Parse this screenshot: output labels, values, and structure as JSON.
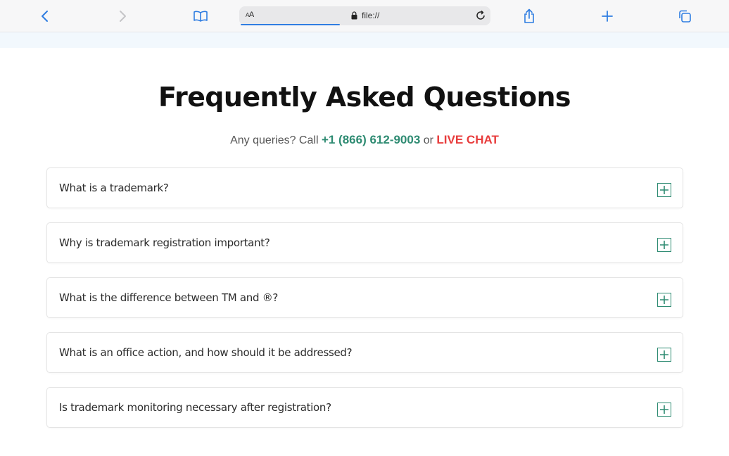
{
  "browser": {
    "url_text_size_label_small": "A",
    "url_text_size_label_large": "A",
    "url": "file://",
    "icons": {
      "back": "chevron-left-icon",
      "forward": "chevron-right-icon",
      "reader": "book-icon",
      "lock": "lock-icon",
      "reload": "reload-icon",
      "share": "share-icon",
      "new_tab": "plus-icon",
      "tabs": "tabs-icon"
    },
    "accent_color": "#2f7de1"
  },
  "page": {
    "title": "Frequently Asked Questions",
    "subtitle": {
      "prefix": "Any queries? Call ",
      "phone": "+1 (866) 612-9003",
      "middle": " or ",
      "chat": "LIVE CHAT"
    },
    "colors": {
      "phone": "#2e8b72",
      "chat": "#e83c3c",
      "toggle": "#2e8b72"
    }
  },
  "faq": {
    "items": [
      {
        "question": "What is a trademark?"
      },
      {
        "question": "Why is trademark registration important?"
      },
      {
        "question": "What is the difference between TM and ®?"
      },
      {
        "question": "What is an office action, and how should it be addressed?"
      },
      {
        "question": "Is trademark monitoring necessary after registration?"
      }
    ],
    "toggle_icon": "plus-square-icon"
  }
}
